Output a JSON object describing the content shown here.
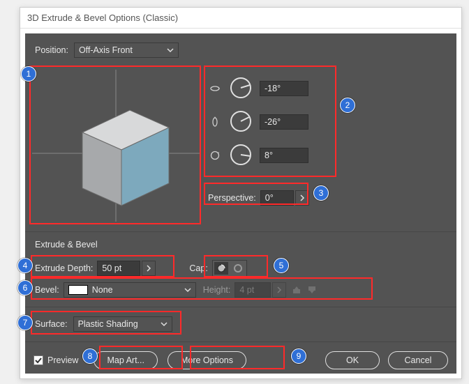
{
  "window": {
    "title": "3D Extrude & Bevel Options (Classic)"
  },
  "position": {
    "label": "Position:",
    "value": "Off-Axis Front"
  },
  "rotation": {
    "x_value": "-18°",
    "y_value": "-26°",
    "z_value": "8°"
  },
  "perspective": {
    "label": "Perspective:",
    "value": "0°"
  },
  "section_eb": "Extrude & Bevel",
  "extrude_depth": {
    "label": "Extrude Depth:",
    "value": "50 pt"
  },
  "cap": {
    "label": "Cap:"
  },
  "bevel": {
    "label": "Bevel:",
    "value": "None"
  },
  "bevel_height": {
    "label": "Height:",
    "value": "4 pt"
  },
  "surface": {
    "label": "Surface:",
    "value": "Plastic Shading"
  },
  "footer": {
    "preview_label": "Preview",
    "map_art": "Map Art...",
    "more_options": "More Options",
    "ok": "OK",
    "cancel": "Cancel"
  },
  "annotations": [
    "1",
    "2",
    "3",
    "4",
    "5",
    "6",
    "7",
    "8",
    "9"
  ]
}
